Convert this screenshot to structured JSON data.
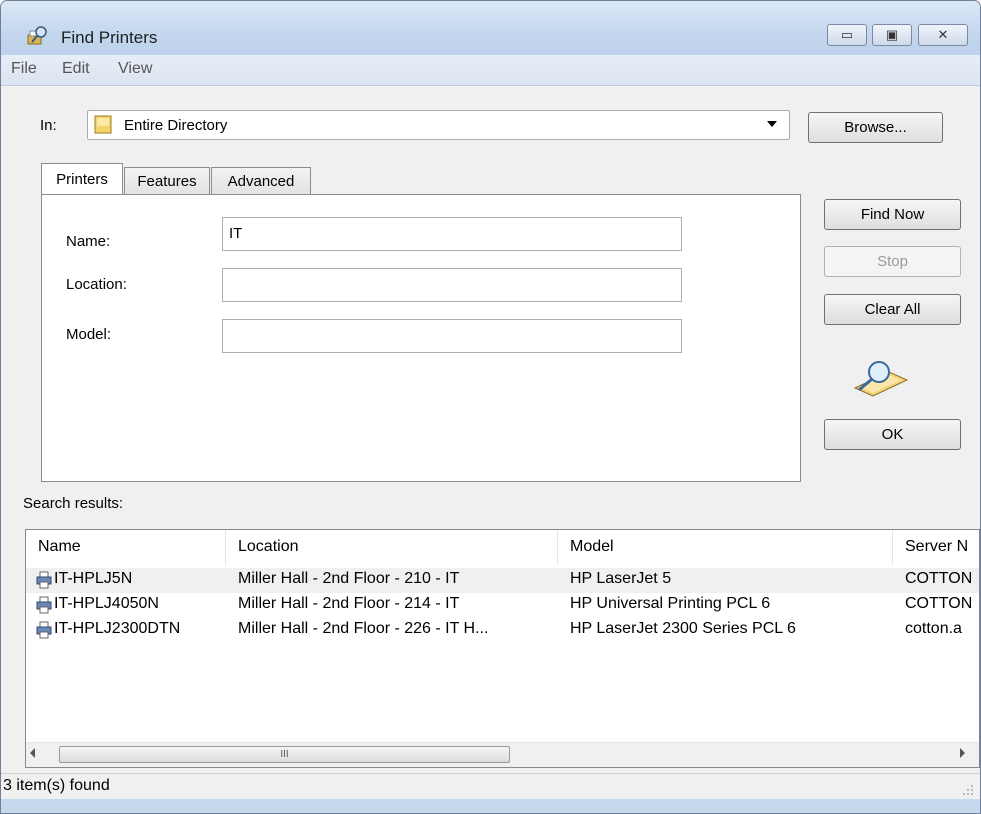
{
  "window": {
    "title": "Find Printers"
  },
  "window_controls": {
    "minimize": "▭",
    "maximize": "▣",
    "close": "✕"
  },
  "menu": [
    "File",
    "Edit",
    "View"
  ],
  "scope": {
    "label": "In:",
    "value": "Entire Directory",
    "browse": "Browse..."
  },
  "tabs": [
    "Printers",
    "Features",
    "Advanced"
  ],
  "fields": {
    "name": {
      "label": "Name:",
      "value": "IT"
    },
    "location": {
      "label": "Location:",
      "value": ""
    },
    "model": {
      "label": "Model:",
      "value": ""
    }
  },
  "actions": {
    "find_now": "Find Now",
    "stop": "Stop",
    "clear_all": "Clear All",
    "ok": "OK"
  },
  "results": {
    "label": "Search results:",
    "columns": [
      "Name",
      "Location",
      "Model",
      "Server N"
    ],
    "rows": [
      {
        "name": "IT-HPLJ5N",
        "location": "Miller Hall - 2nd Floor - 210 - IT",
        "model": "HP LaserJet 5",
        "server": "COTTON"
      },
      {
        "name": "IT-HPLJ4050N",
        "location": "Miller Hall - 2nd Floor - 214 - IT",
        "model": "HP Universal Printing PCL 6",
        "server": "COTTON"
      },
      {
        "name": "IT-HPLJ2300DTN",
        "location": "Miller Hall - 2nd Floor - 226 - IT H...",
        "model": "HP LaserJet 2300 Series PCL 6",
        "server": "cotton.a"
      }
    ],
    "scroll_thumb": "III"
  },
  "status": {
    "text": "3 item(s) found"
  },
  "colors": {
    "titlebar": "#c4d7ee",
    "frame": "#c6d8ec",
    "client": "#f0f0f0"
  }
}
